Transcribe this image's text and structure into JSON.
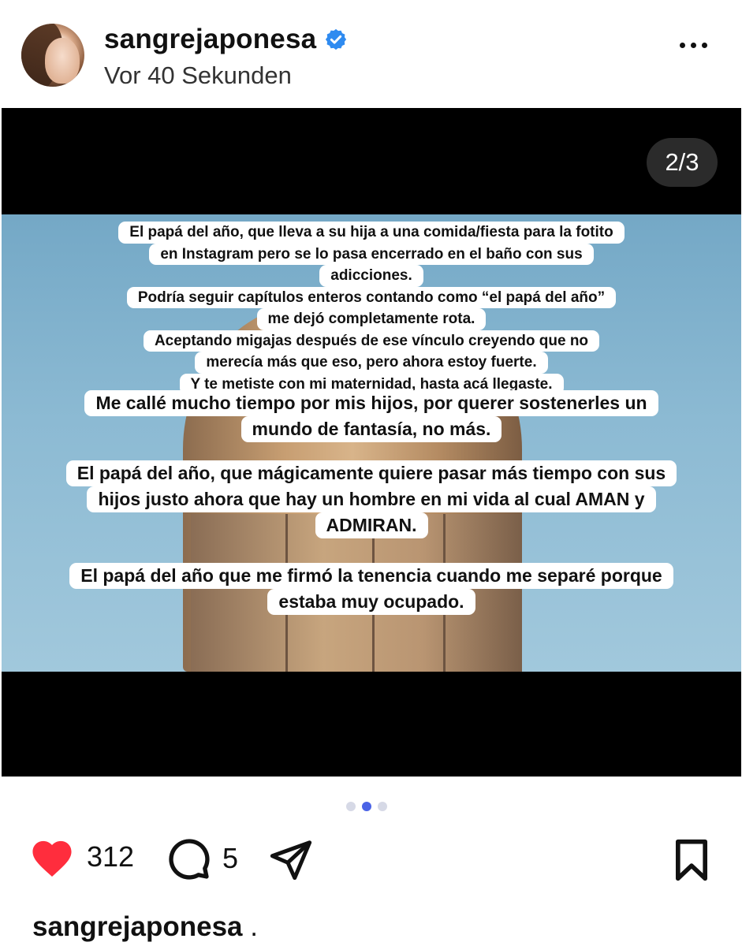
{
  "post": {
    "username": "sangrejaponesa",
    "timestamp": "Vor 40 Sekunden"
  },
  "media": {
    "slide_counter": "2/3",
    "text_overlay": {
      "group1": [
        "El papá del año, que lleva a su hija a una comida/fiesta para la fotito",
        "en Instagram pero se lo pasa encerrado en el baño con sus",
        "adicciones.",
        "Podría seguir capítulos enteros contando como “el papá del año”",
        "me dejó completamente rota.",
        "Aceptando migajas después de ese vínculo creyendo que no",
        "merecía más que eso, pero ahora estoy fuerte.",
        "Y te metiste con mi maternidad, hasta acá llegaste."
      ],
      "group2": [
        "Me callé mucho tiempo por mis hijos, por querer sostenerles un",
        "mundo de fantasía, no más."
      ],
      "group3": [
        "El papá del año, que mágicamente quiere pasar más tiempo con sus",
        "hijos justo ahora que hay un hombre en mi vida al cual AMAN y",
        "ADMIRAN."
      ],
      "group4": [
        "El papá del año que me firmó la tenencia cuando me separé porque",
        "estaba muy ocupado."
      ]
    },
    "carousel": {
      "total": 3,
      "active_index": 1
    }
  },
  "actions": {
    "likes": "312",
    "comments": "5"
  },
  "caption": {
    "username": "sangrejaponesa",
    "text": " ."
  },
  "colors": {
    "like_red": "#ff2d3d",
    "verified_blue": "#2f8bf0",
    "dot_active": "#4a63e6",
    "dot_inactive": "#d6d9e6"
  },
  "icons": [
    "verified-badge-icon",
    "more-options-icon",
    "heart-icon",
    "comment-icon",
    "share-icon",
    "bookmark-icon"
  ]
}
